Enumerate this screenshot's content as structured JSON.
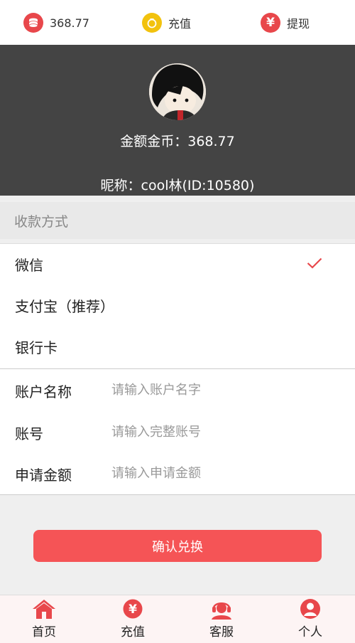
{
  "topbar": {
    "balance": "368.77",
    "recharge_label": "充值",
    "withdraw_label": "提现"
  },
  "profile": {
    "balance_text": "金额金币：368.77",
    "nickname_text": "昵称：cool林(ID:10580)"
  },
  "payment": {
    "header": "收款方式",
    "options": [
      {
        "label": "微信",
        "selected": true
      },
      {
        "label": "支付宝（推荐）",
        "selected": false
      },
      {
        "label": "银行卡",
        "selected": false
      }
    ]
  },
  "form": {
    "account_name_label": "账户名称",
    "account_name_placeholder": "请输入账户名字",
    "account_no_label": "账号",
    "account_no_placeholder": "请输入完整账号",
    "amount_label": "申请金额",
    "amount_placeholder": "请输入申请金额"
  },
  "confirm_label": "确认兑换",
  "tabbar": {
    "home": "首页",
    "recharge": "充值",
    "service": "客服",
    "personal": "个人"
  },
  "colors": {
    "accent": "#f55456",
    "icon_red": "#e8474b",
    "icon_gold": "#f2c20e",
    "header_bg": "#444444"
  }
}
